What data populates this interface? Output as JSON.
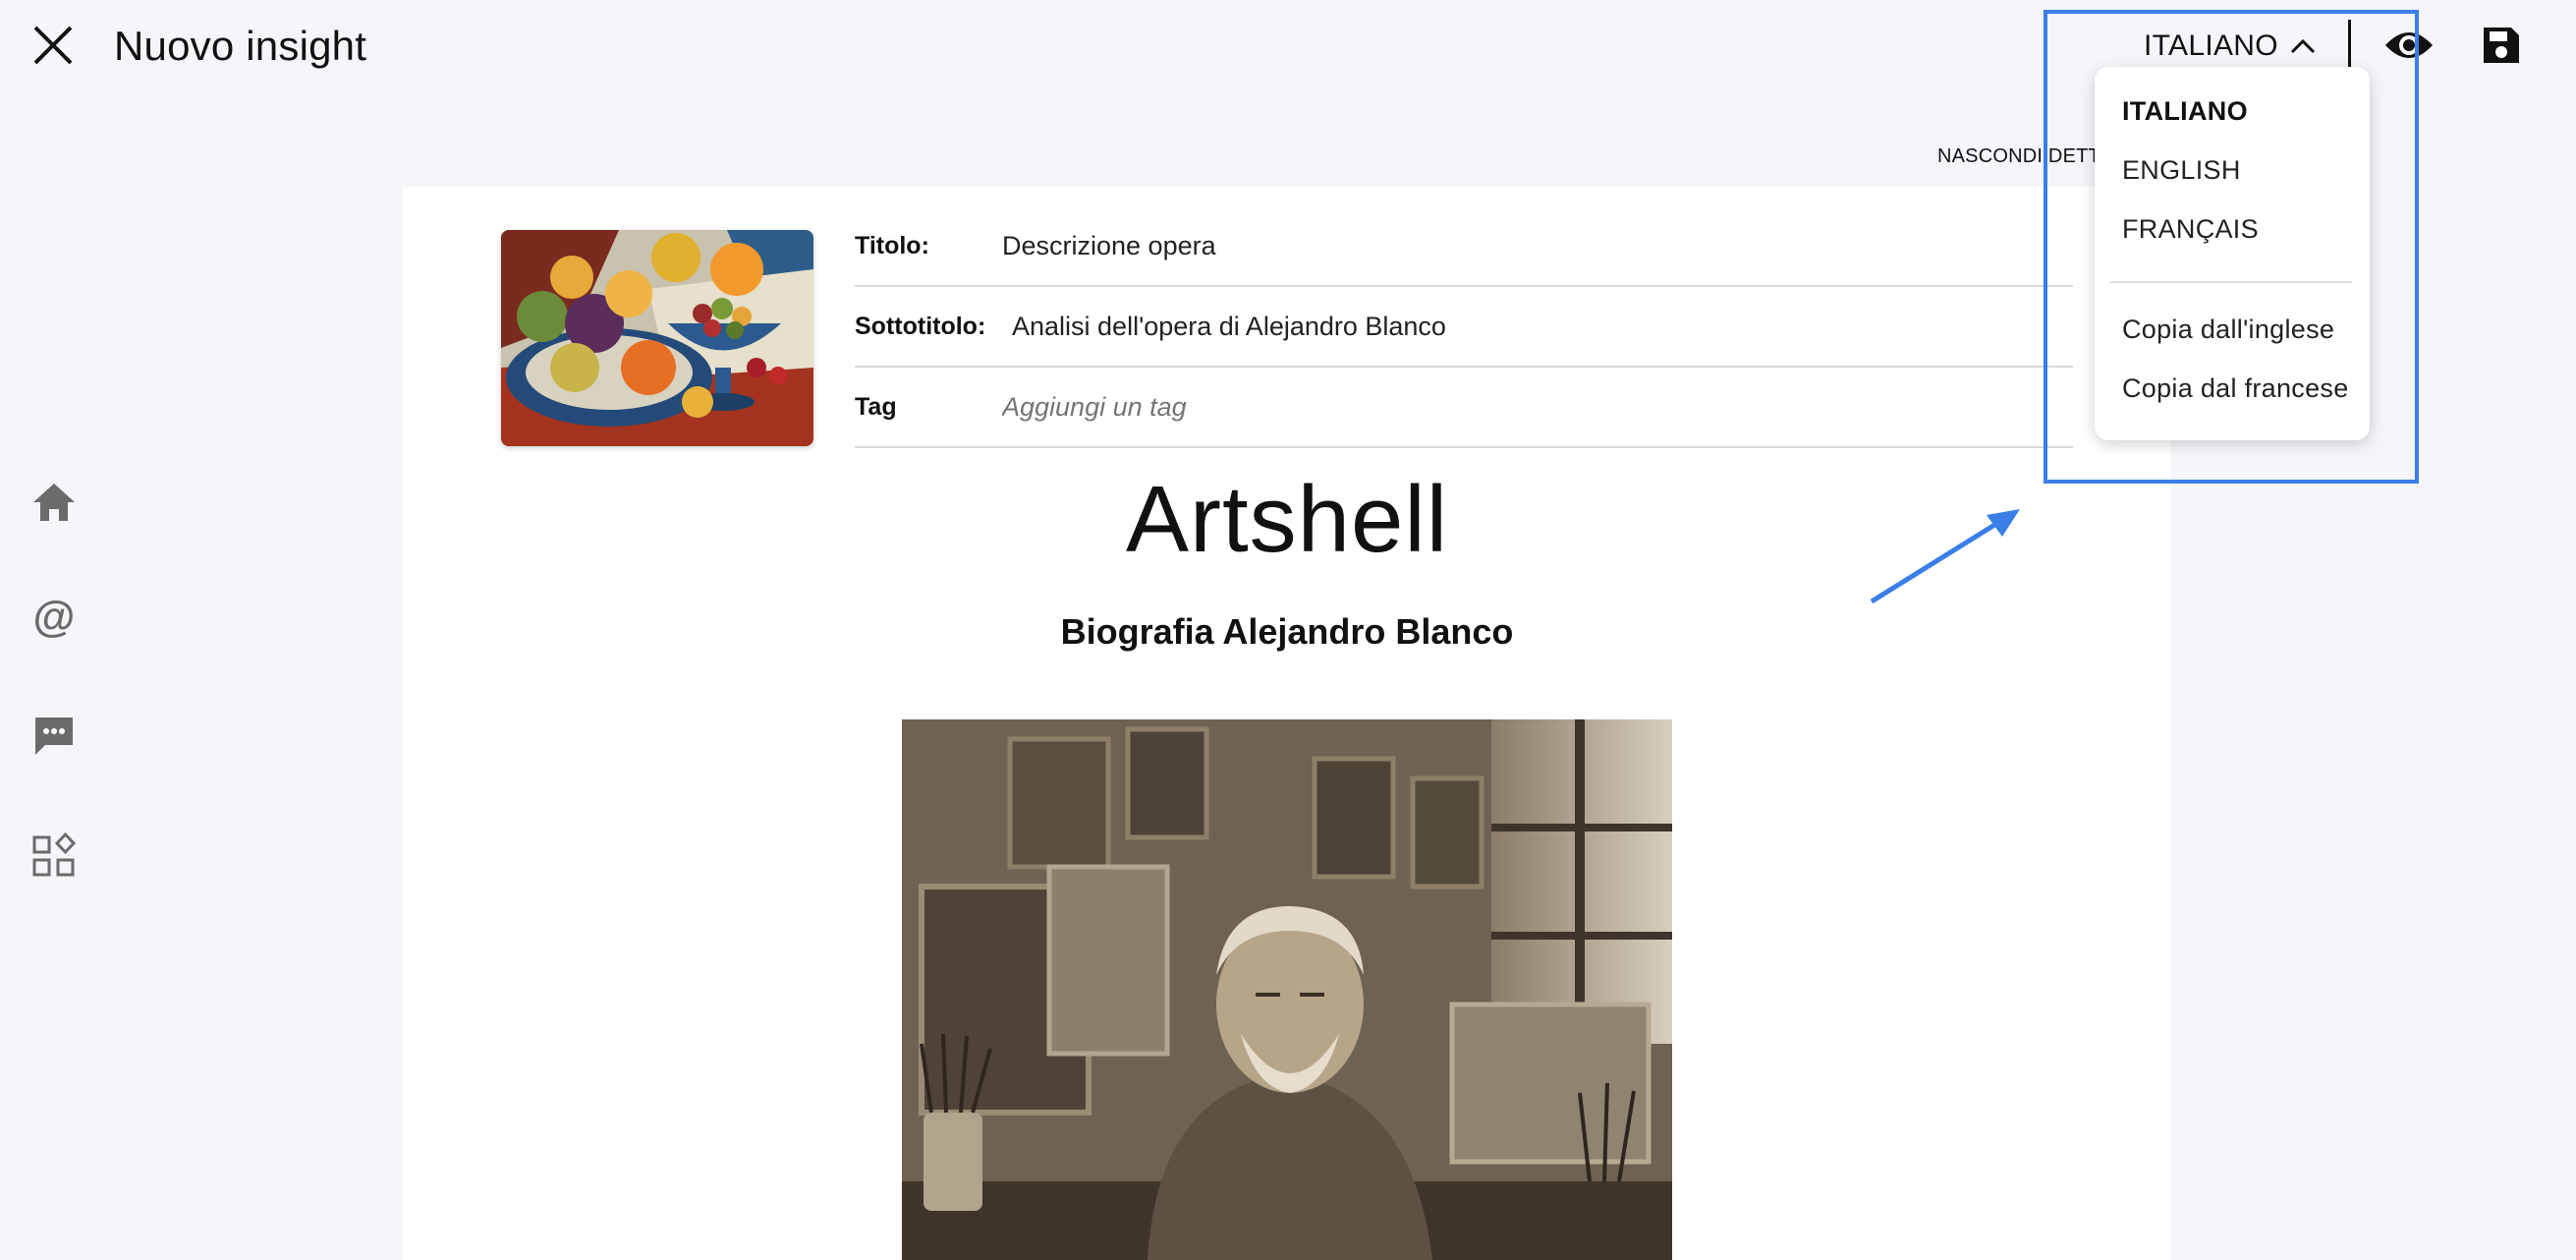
{
  "header": {
    "title": "Nuovo insight",
    "language_selected": "ITALIANO"
  },
  "hide_details_label": "NASCONDI DETTAGLI",
  "form": {
    "title_label": "Titolo:",
    "title_value": "Descrizione opera",
    "subtitle_label": "Sottotitolo:",
    "subtitle_value": "Analisi dell'opera di Alejandro Blanco",
    "tag_label": "Tag",
    "tag_placeholder": "Aggiungi un tag"
  },
  "content": {
    "brand": "Artshell",
    "heading": "Biografia Alejandro Blanco"
  },
  "language_menu": {
    "languages": [
      "ITALIANO",
      "ENGLISH",
      "FRANÇAIS"
    ],
    "actions": [
      "Copia dall'inglese",
      "Copia dal francese"
    ]
  },
  "sidebar": {
    "icons": [
      "home-icon",
      "at-icon",
      "chat-icon",
      "widgets-icon"
    ]
  },
  "colors": {
    "highlight": "#3a7ee8",
    "background": "#f4f6fa"
  }
}
